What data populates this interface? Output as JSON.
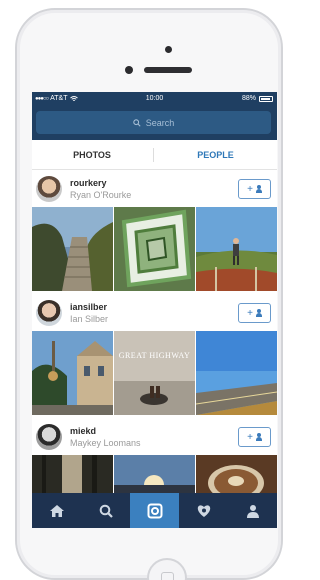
{
  "status_bar": {
    "carrier": "AT&T",
    "time": "10:00",
    "battery": "88%",
    "battery_level": 0.88
  },
  "search": {
    "placeholder": "Search"
  },
  "tabs": [
    {
      "label": "PHOTOS",
      "active": false
    },
    {
      "label": "PEOPLE",
      "active": true
    }
  ],
  "users": [
    {
      "username": "rourkery",
      "full_name": "Ryan O'Rourke",
      "follow_label": "+"
    },
    {
      "username": "iansilber",
      "full_name": "Ian Silber",
      "follow_label": "+"
    },
    {
      "username": "miekd",
      "full_name": "Maykey Loomans",
      "follow_label": "+"
    }
  ],
  "photo_text": {
    "sign": "GREAT HIGHWAY"
  },
  "bottom_nav": [
    {
      "icon": "home-icon",
      "active": false
    },
    {
      "icon": "search-icon",
      "active": false
    },
    {
      "icon": "camera-icon",
      "active": true
    },
    {
      "icon": "activity-icon",
      "active": false
    },
    {
      "icon": "profile-icon",
      "active": false
    }
  ],
  "colors": {
    "header": "#1f3f62",
    "accent": "#3b80bf",
    "nav": "#1e3250"
  }
}
